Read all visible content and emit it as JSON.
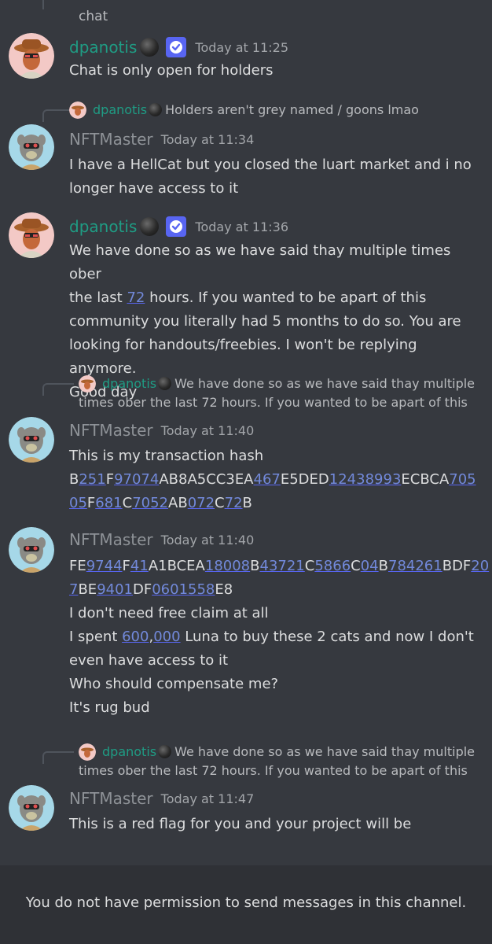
{
  "top_reply": {
    "text": "chat"
  },
  "messages": [
    {
      "author": "dpanotis",
      "time": "Today at 11:25",
      "lines": [
        "Chat is only open for holders"
      ]
    },
    {
      "reply": {
        "author": "dpanotis",
        "text": "Holders aren't grey named / goons lmao"
      },
      "author": "NFTMaster",
      "time": "Today at 11:34",
      "lines": [
        "I have a HellCat but you closed the luart market and i no",
        "longer have access to it"
      ]
    },
    {
      "author": "dpanotis",
      "time": "Today at 11:36",
      "line1_a": "We have done so as we have said thay multiple times ober",
      "line2_a": "the last ",
      "line2_link": "72",
      "line2_b": " hours. If you wanted to be apart of this",
      "lines_rest": [
        "community you literally had 5 months to do so. You are",
        "looking for handouts/freebies. I won't be replying anymore.",
        "Good day"
      ]
    },
    {
      "reply": {
        "author": "dpanotis",
        "text_1": "We have done so as we have said thay multiple",
        "text_2": "times ober the last 72 hours. If you wanted to be apart of this"
      },
      "author": "NFTMaster",
      "time": "Today at 11:40",
      "line1": "This is my transaction hash",
      "hash_1": [
        "B",
        "251",
        "F",
        "97074",
        "AB8A5CC3EA",
        "467",
        "E5DED",
        "12438993",
        "ECBCA",
        "705"
      ],
      "hash_2": [
        "05",
        "F",
        "681",
        "C",
        "7052",
        "AB",
        "072",
        "C",
        "72",
        "B"
      ]
    },
    {
      "author": "NFTMaster",
      "time": "Today at 11:40",
      "hash_1": [
        "FE",
        "9744",
        "F",
        "41",
        "A1BCEA",
        "18008",
        "B",
        "43721",
        "C",
        "5866",
        "C",
        "04",
        "B",
        "784261",
        "BDF",
        "20"
      ],
      "hash_2": [
        "7",
        "BE",
        "9401",
        "DF",
        "0601558",
        "E8"
      ],
      "line_a": "I don't need free claim at all",
      "line_b1": "I spent ",
      "line_b_link1": "600",
      "line_b_comma": ",",
      "line_b_link2": "000",
      "line_b2": " Luna to buy these 2 cats and now I don't",
      "lines_rest": [
        "even have access to it",
        "Who should compensate me?",
        "It's rug bud"
      ]
    },
    {
      "reply": {
        "author": "dpanotis",
        "text_1": "We have done so as we have said thay multiple",
        "text_2": "times ober the last 72 hours. If you wanted to be apart of this"
      },
      "author": "NFTMaster",
      "time": "Today at 11:47",
      "lines": [
        "This is a red flag for you and your project will be"
      ]
    }
  ],
  "footer": {
    "permission_text": "You do not have permission to send messages in this channel."
  },
  "colors": {
    "background": "#36393f",
    "dpanotis_name": "#1f9c84",
    "nftmaster_name": "#8e9297",
    "link": "#7289da",
    "verified": "#5865f2"
  }
}
